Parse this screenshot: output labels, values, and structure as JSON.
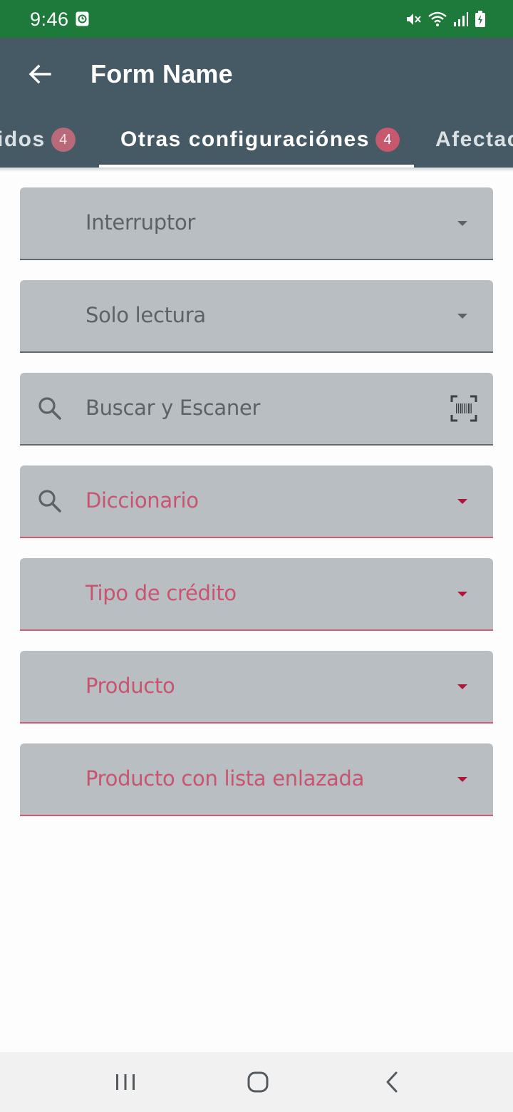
{
  "status_bar": {
    "time": "9:46",
    "icons": [
      "clock-icon",
      "mute-icon",
      "wifi-icon",
      "signal-icon",
      "battery-icon"
    ],
    "background": "#1e7a3a"
  },
  "app_bar": {
    "title": "Form Name",
    "back_icon": "arrow-left-icon",
    "background": "#455a64"
  },
  "tabs": [
    {
      "label": "idos",
      "badge": "4",
      "active": false
    },
    {
      "label": "Otras configuraciónes",
      "badge": "4",
      "active": true
    },
    {
      "label": "Afectac",
      "badge": "",
      "active": false
    }
  ],
  "fields": [
    {
      "label": "Interruptor",
      "type": "dropdown",
      "required": false
    },
    {
      "label": "Solo lectura",
      "type": "dropdown",
      "required": false
    },
    {
      "label": "Buscar y Escaner",
      "type": "search-scan",
      "required": false,
      "icons": [
        "search-icon",
        "barcode-scan-icon"
      ]
    },
    {
      "label": "Diccionario",
      "type": "search-dropdown",
      "required": true,
      "icons": [
        "search-icon"
      ]
    },
    {
      "label": "Tipo de crédito",
      "type": "dropdown",
      "required": true
    },
    {
      "label": "Producto",
      "type": "dropdown",
      "required": true
    },
    {
      "label": "Producto con lista enlazada",
      "type": "dropdown",
      "required": true
    }
  ],
  "colors": {
    "accent_error": "#c85470",
    "field_background": "#b8bec2",
    "badge": "#c7586d"
  },
  "nav_bar": {
    "icons": [
      "recent-apps-icon",
      "home-icon",
      "back-icon"
    ]
  }
}
